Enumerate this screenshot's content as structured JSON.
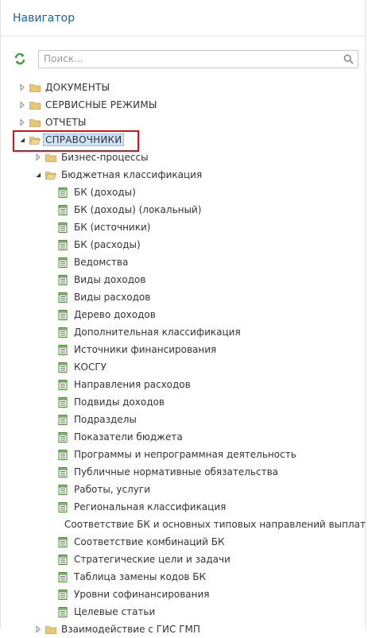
{
  "header": {
    "title": "Навигатор"
  },
  "toolbar": {
    "search_placeholder": "Поиск..."
  },
  "tree": {
    "root": [
      {
        "label": "ДОКУМЕНТЫ"
      },
      {
        "label": "СЕРВИСНЫЕ РЕЖИМЫ"
      },
      {
        "label": "ОТЧЕТЫ"
      },
      {
        "label": "СПРАВОЧНИКИ"
      }
    ],
    "spravochniki_children": [
      {
        "label": "Бизнес-процессы"
      },
      {
        "label": "Бюджетная классификация"
      }
    ],
    "budget_items": [
      "БК (доходы)",
      "БК (доходы) (локальный)",
      "БК (источники)",
      "БК (расходы)",
      "Ведомства",
      "Виды доходов",
      "Виды расходов",
      "Дерево доходов",
      "Дополнительная классификация",
      "Источники финансирования",
      "КОСГУ",
      "Направления расходов",
      "Подвиды доходов",
      "Подразделы",
      "Показатели бюджета",
      "Программы и непрограммная деятельность",
      "Публичные нормативные обязательства",
      "Работы, услуги",
      "Региональная классификация",
      "Соответствие БК и основных типовых направлений выплат",
      "Соответствие комбинаций БК",
      "Стратегические цели и задачи",
      "Таблица замены кодов БК",
      "Уровни софинансирования",
      "Целевые статьи"
    ],
    "partial_label": "Взаимодействие с ГИС ГМП"
  },
  "colors": {
    "header_title": "#1e5f9e",
    "refresh_icon": "#3aa03a",
    "folder": "#e8c779",
    "selection_bg": "#cfe3f7",
    "highlight_border": "#e0101a"
  }
}
